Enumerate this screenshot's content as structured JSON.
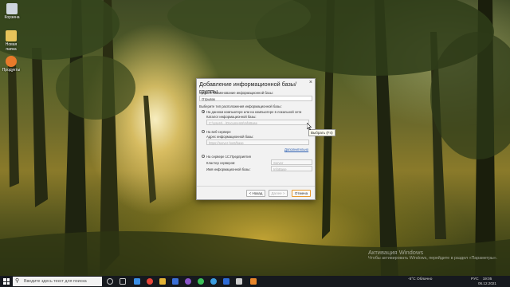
{
  "desktop": {
    "icons": [
      {
        "label": "Корзина",
        "name": "recycle-bin-icon"
      },
      {
        "label": "Новая папка",
        "name": "folder-icon"
      },
      {
        "label": "Продукты",
        "name": "app-shortcut-icon"
      }
    ],
    "watermark": {
      "title": "Активация Windows",
      "subtitle": "Чтобы активировать Windows, перейдите в раздел «Параметры»."
    }
  },
  "dialog": {
    "title": "Добавление информационной базы/группы",
    "name_label": "Укажите наименование информационной базы:",
    "name_value": "Отрывок",
    "location_label": "Выберите тип расположения информационной базы:",
    "options": [
      {
        "label": "На данном компьютере или на компьютере в локальной сети",
        "selected": true
      },
      {
        "label": "На веб-сервере",
        "selected": false
      },
      {
        "label": "На сервере 1С:Предприятия",
        "selected": false
      }
    ],
    "catalog_label": "Каталог информационной базы:",
    "catalog_value": "C:\\Users\\...\\Documents\\InfoBase",
    "address_label": "Адрес информационной базы:",
    "address_placeholder": "https://server-host/base",
    "extra_link": "Дополнительно",
    "cluster_label": "Кластер серверов:",
    "cluster_value": "Server",
    "ibname_label": "Имя информационной базы:",
    "ibname_value": "InfoBase",
    "buttons": {
      "back": "< Назад",
      "next": "Далее >",
      "cancel": "Отмена"
    },
    "tooltip": "Выбрать (F4)"
  },
  "taskbar": {
    "search_placeholder": "Введите здесь текст для поиска",
    "weather": "-5°С  Облачно",
    "lang": "РУС",
    "time": "19:05",
    "date": "06.12.2021"
  },
  "colors": {
    "taskbar": "#16191e",
    "link": "#2a5db0",
    "default_button_border": "#e89a2e"
  }
}
